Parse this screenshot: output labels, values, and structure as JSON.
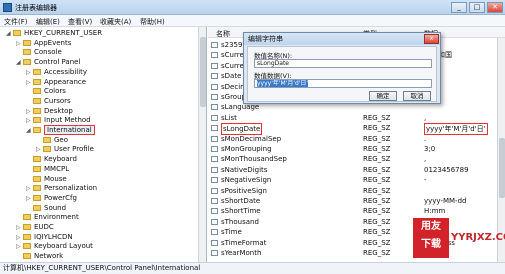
{
  "window": {
    "title": "注册表编辑器"
  },
  "menu": [
    "文件(F)",
    "编辑(E)",
    "查看(V)",
    "收藏夹(A)",
    "帮助(H)"
  ],
  "tree": [
    {
      "label": "HKEY_CURRENT_USER",
      "indent": 0,
      "exp": "◢",
      "folder": true
    },
    {
      "label": "AppEvents",
      "indent": 1,
      "exp": "▷",
      "folder": true
    },
    {
      "label": "Console",
      "indent": 1,
      "exp": "",
      "folder": true
    },
    {
      "label": "Control Panel",
      "indent": 1,
      "exp": "◢",
      "folder": true
    },
    {
      "label": "Accessibility",
      "indent": 2,
      "exp": "▷",
      "folder": true
    },
    {
      "label": "Appearance",
      "indent": 2,
      "exp": "▷",
      "folder": true
    },
    {
      "label": "Colors",
      "indent": 2,
      "exp": "",
      "folder": true
    },
    {
      "label": "Cursors",
      "indent": 2,
      "exp": "",
      "folder": true
    },
    {
      "label": "Desktop",
      "indent": 2,
      "exp": "▷",
      "folder": true
    },
    {
      "label": "Input Method",
      "indent": 2,
      "exp": "▷",
      "folder": true
    },
    {
      "label": "International",
      "indent": 2,
      "exp": "◢",
      "folder": true,
      "selected": true
    },
    {
      "label": "Geo",
      "indent": 3,
      "exp": "",
      "folder": true
    },
    {
      "label": "User Profile",
      "indent": 3,
      "exp": "▷",
      "folder": true
    },
    {
      "label": "Keyboard",
      "indent": 2,
      "exp": "",
      "folder": true
    },
    {
      "label": "MMCPL",
      "indent": 2,
      "exp": "",
      "folder": true
    },
    {
      "label": "Mouse",
      "indent": 2,
      "exp": "",
      "folder": true
    },
    {
      "label": "Personalization",
      "indent": 2,
      "exp": "▷",
      "folder": true
    },
    {
      "label": "PowerCfg",
      "indent": 2,
      "exp": "▷",
      "folder": true
    },
    {
      "label": "Sound",
      "indent": 2,
      "exp": "",
      "folder": true
    },
    {
      "label": "Environment",
      "indent": 1,
      "exp": "",
      "folder": true
    },
    {
      "label": "EUDC",
      "indent": 1,
      "exp": "▷",
      "folder": true
    },
    {
      "label": "IQIYLHCDN",
      "indent": 1,
      "exp": "▷",
      "folder": true
    },
    {
      "label": "Keyboard Layout",
      "indent": 1,
      "exp": "▷",
      "folder": true
    },
    {
      "label": "Network",
      "indent": 1,
      "exp": "",
      "folder": true
    }
  ],
  "list": {
    "header": {
      "name": "名称",
      "type": "类型",
      "data": "数据"
    },
    "rows": [
      {
        "name": "s2359",
        "type": "",
        "data": ""
      },
      {
        "name": "sCurrency",
        "type": "",
        "data": "民共和国"
      },
      {
        "name": "sCurrency",
        "type": "",
        "data": ""
      },
      {
        "name": "sDate",
        "type": "",
        "data": ""
      },
      {
        "name": "sDecimal",
        "type": "",
        "data": ""
      },
      {
        "name": "sGrouping",
        "type": "",
        "data": ""
      },
      {
        "name": "sLanguage",
        "type": "",
        "data": ""
      },
      {
        "name": "sList",
        "type": "REG_SZ",
        "data": ","
      },
      {
        "name": "sLongDate",
        "type": "REG_SZ",
        "data": "yyyy'年'M'月'd'日'",
        "selected": true
      },
      {
        "name": "sMonDecimalSep",
        "type": "REG_SZ",
        "data": "."
      },
      {
        "name": "sMonGrouping",
        "type": "REG_SZ",
        "data": "3;0"
      },
      {
        "name": "sMonThousandSep",
        "type": "REG_SZ",
        "data": ","
      },
      {
        "name": "sNativeDigits",
        "type": "REG_SZ",
        "data": "0123456789"
      },
      {
        "name": "sNegativeSign",
        "type": "REG_SZ",
        "data": "-"
      },
      {
        "name": "sPositiveSign",
        "type": "REG_SZ",
        "data": ""
      },
      {
        "name": "sShortDate",
        "type": "REG_SZ",
        "data": "yyyy-MM-dd"
      },
      {
        "name": "sShortTime",
        "type": "REG_SZ",
        "data": "H:mm"
      },
      {
        "name": "sThousand",
        "type": "REG_SZ",
        "data": ","
      },
      {
        "name": "sTime",
        "type": "REG_SZ",
        "data": ":"
      },
      {
        "name": "sTimeFormat",
        "type": "REG_SZ",
        "data": "H:mm:ss"
      },
      {
        "name": "sYearMonth",
        "type": "REG_SZ",
        "data": ""
      }
    ]
  },
  "dialog": {
    "title": "编辑字符串",
    "name_label": "数值名称(N):",
    "name_value": "sLongDate",
    "data_label": "数值数据(V):",
    "data_value": "yyyy'年'M'月'd'日'",
    "ok": "确定",
    "cancel": "取消",
    "close": "x"
  },
  "status": "计算机\\HKEY_CURRENT_USER\\Control Panel\\International",
  "watermark": {
    "logo_top": "用友",
    "logo_bottom": "下载",
    "site": "YYRJXZ.COM"
  }
}
